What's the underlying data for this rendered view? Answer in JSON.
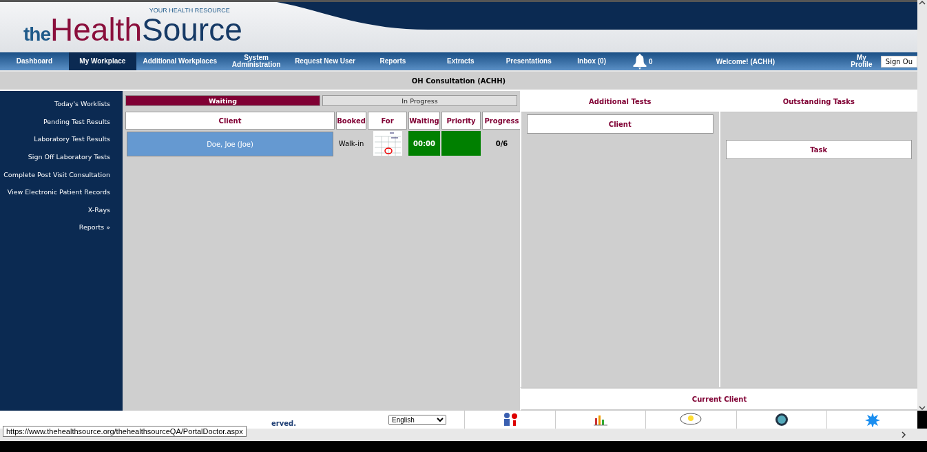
{
  "header": {
    "logo_prefix": "the",
    "logo_main": "Health",
    "logo_suffix": "Source",
    "tagline": "YOUR HEALTH RESOURCE"
  },
  "nav": [
    {
      "label": "Dashboard",
      "selected": false
    },
    {
      "label": "My Workplace",
      "selected": true
    },
    {
      "label": "Additional Workplaces",
      "selected": false
    },
    {
      "label": "System Administration",
      "selected": false
    },
    {
      "label": "Request New User",
      "selected": false
    },
    {
      "label": "Reports",
      "selected": false
    },
    {
      "label": "Extracts",
      "selected": false
    },
    {
      "label": "Presentations",
      "selected": false
    },
    {
      "label": "Inbox (0)",
      "selected": false
    }
  ],
  "notifications": "0",
  "welcome": "Welcome! (ACHH)",
  "profile": "My Profile",
  "sign_out": "Sign Ou",
  "page_title": "OH Consultation (ACHH)",
  "sidebar": {
    "items": [
      "Today's Worklists",
      "Pending Test Results",
      "Laboratory Test Results",
      "Sign Off Laboratory Tests",
      "Complete Post Visit Consultation",
      "View Electronic Patient Records",
      "X-Rays",
      "Reports »"
    ]
  },
  "status_tabs": [
    {
      "label": "Waiting",
      "selected": true
    },
    {
      "label": "In Progress",
      "selected": false
    }
  ],
  "table": {
    "columns": [
      "Client",
      "Booked",
      "For",
      "Waiting",
      "Priority",
      "Progress"
    ],
    "rows": [
      {
        "client": "Doe, Joe (Joe)",
        "booked": "Walk-in",
        "waiting": "00:00",
        "progress": "0/6"
      }
    ]
  },
  "additional_tests": {
    "title": "Additional Tests",
    "column": "Client"
  },
  "outstanding_tasks": {
    "title": "Outstanding Tasks",
    "column": "Task"
  },
  "current_client": "Current Client",
  "footer": {
    "copyright": "erved.",
    "language": "English"
  },
  "status_url": "https://www.thehealthsource.org/thehealthsourceQA/PortalDoctor.aspx"
}
